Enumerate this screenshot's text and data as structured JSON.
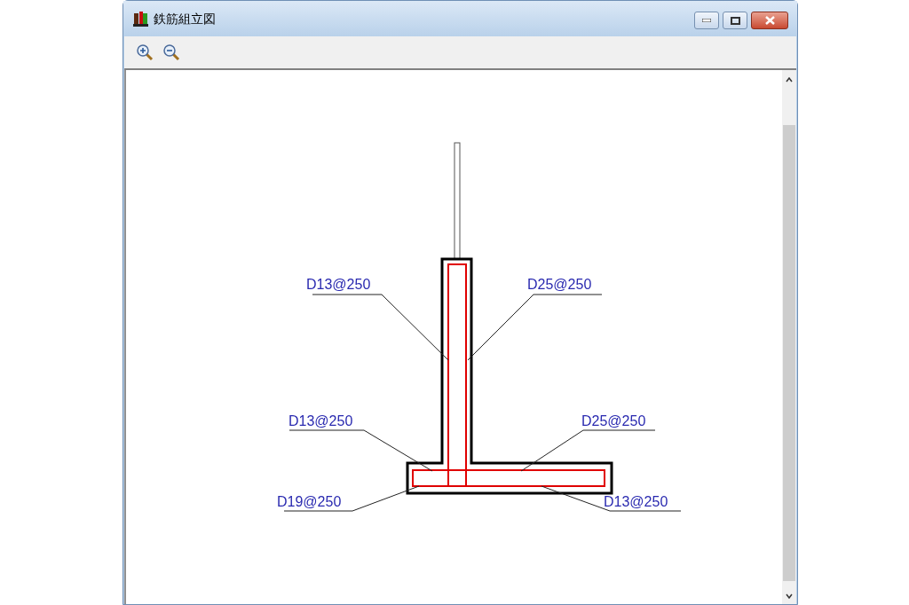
{
  "window": {
    "title": "鉄筋組立図"
  },
  "toolbar": {
    "buttons": [
      {
        "kind": "zoom-in"
      },
      {
        "kind": "zoom-out"
      }
    ]
  },
  "drawing": {
    "labels": [
      {
        "text": "D13@250"
      },
      {
        "text": "D25@250"
      },
      {
        "text": "D13@250"
      },
      {
        "text": "D25@250"
      },
      {
        "text": "D19@250"
      },
      {
        "text": "D13@250"
      }
    ]
  }
}
